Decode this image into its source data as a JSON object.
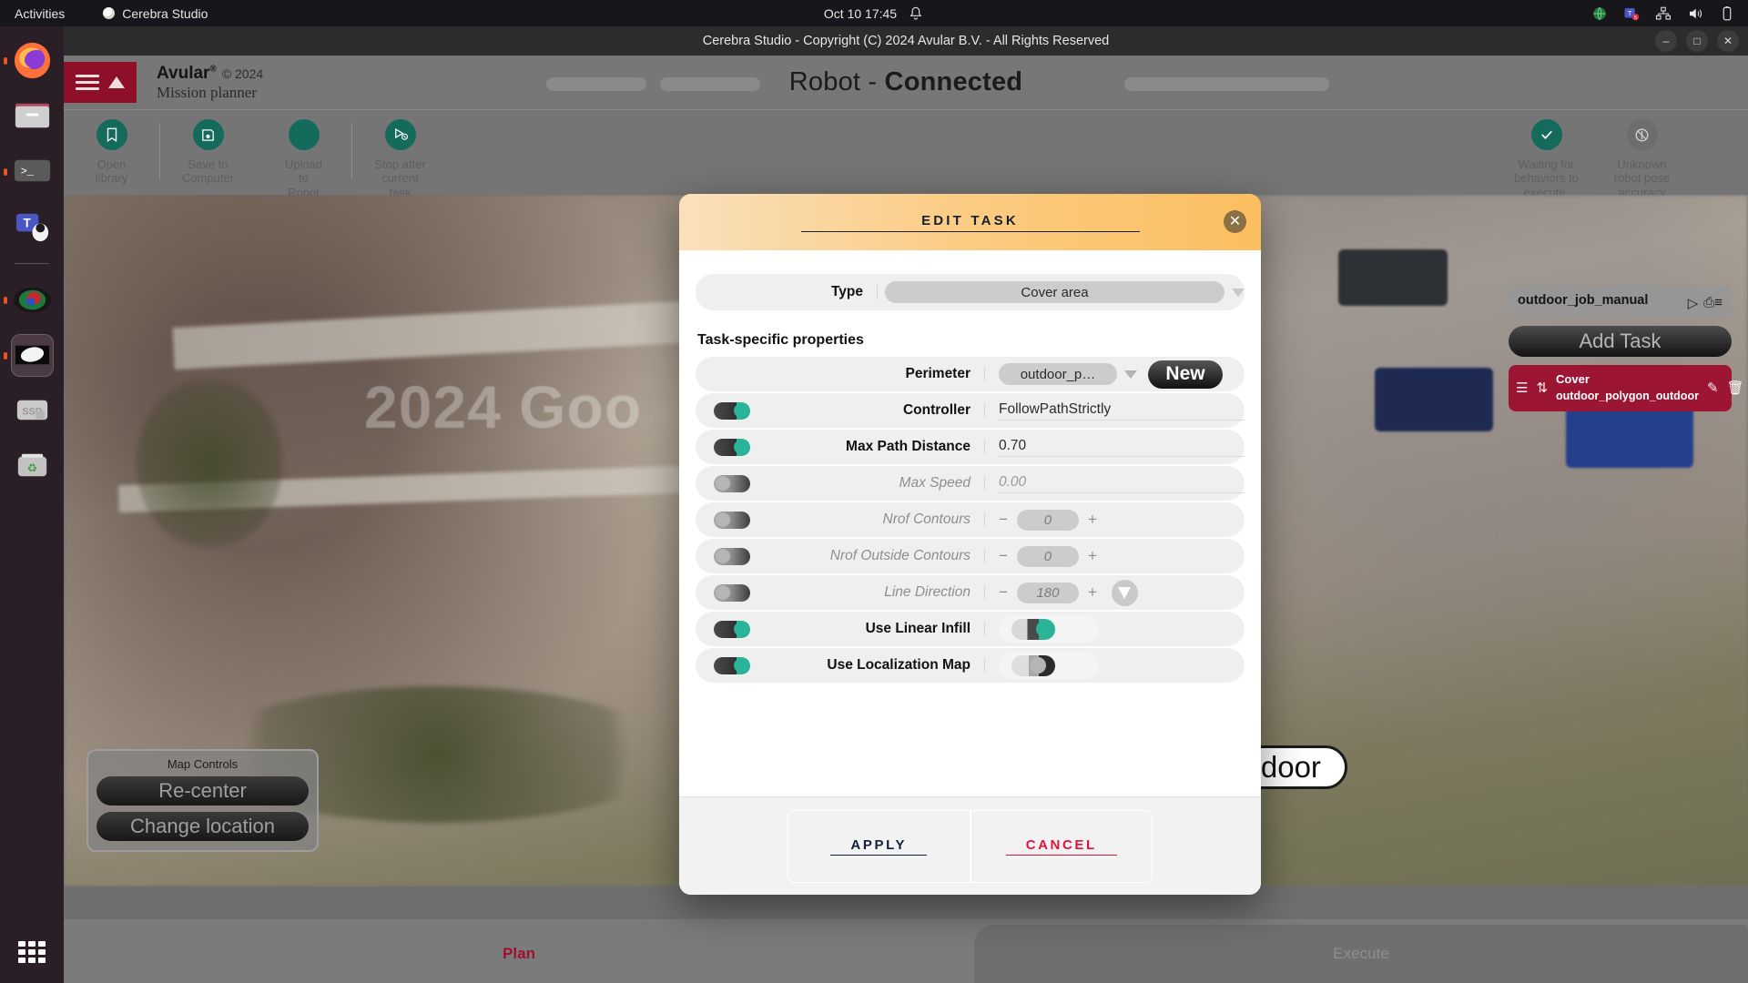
{
  "os": {
    "activities": "Activities",
    "app_name": "Cerebra Studio",
    "clock": "Oct 10  17:45",
    "tray_icons": [
      "globe-icon",
      "teams-icon",
      "network-icon",
      "volume-icon",
      "battery-icon"
    ],
    "dock_items": [
      {
        "name": "firefox",
        "running": true
      },
      {
        "name": "files",
        "running": false
      },
      {
        "name": "terminal",
        "running": true
      },
      {
        "name": "teams",
        "running": false
      },
      {
        "name": "cerebra-globe",
        "running": true
      },
      {
        "name": "media-player",
        "running": true,
        "active": true
      },
      {
        "name": "ssd-drive",
        "label": "SSD",
        "running": false
      },
      {
        "name": "trash",
        "running": false
      }
    ],
    "show_apps": "show-applications"
  },
  "window": {
    "title": "Cerebra Studio - Copyright (C) 2024 Avular B.V. - All Rights Reserved",
    "minimize": "–",
    "maximize": "□",
    "close": "✕"
  },
  "header": {
    "menu_icon": "hamburger-menu-icon",
    "logo_icon": "avular-caret-icon",
    "brand": "Avular",
    "brand_sup": "®",
    "copyright": "© 2024",
    "subtitle": "Mission planner",
    "robot_label": "Robot",
    "robot_dash": " - ",
    "robot_status": "Connected"
  },
  "toolbar": {
    "left_items": [
      {
        "label": "Open\nlibrary",
        "icon": "book-icon",
        "style": "green"
      },
      {
        "label": "Save to\nComputer",
        "icon": "floppy-disk-icon",
        "style": "green"
      },
      {
        "label": "Upload\nto\nRobot",
        "icon": "upload-icon",
        "style": "green"
      },
      {
        "label": "Stop after\ncurrent\ntask",
        "icon": "stop-after-task-icon",
        "style": "green"
      }
    ],
    "right_items": [
      {
        "label": "Waiting for\nbehaviors to\nexecute.",
        "icon": "check-icon",
        "style": "green"
      },
      {
        "label": "Unknown\nrobot pose\naccuracy",
        "icon": "no-location-icon",
        "style": "gray"
      }
    ]
  },
  "map": {
    "watermark": "2024 Goo",
    "polygon_label": "outdoor",
    "controls_title": "Map Controls",
    "recenter_label": "Re-center",
    "change_location_label": "Change location"
  },
  "task_panel": {
    "job_name": "outdoor_job_manual",
    "play_icon": "play-icon",
    "list_icon": "clipboard-list-icon",
    "add_task_label": "Add Task",
    "tasks": [
      {
        "drag_icon": "drag-handle-icon",
        "type_icon": "path-icon",
        "title": "Cover",
        "subtitle": "outdoor_polygon_outdoor",
        "edit_icon": "pencil-icon",
        "delete_icon": "trash-icon"
      }
    ]
  },
  "tabs": {
    "plan": "Plan",
    "execute": "Execute",
    "active": "plan"
  },
  "modal": {
    "title": "EDIT TASK",
    "close_icon": "close-icon",
    "type_label": "Type",
    "type_value": "Cover area",
    "section_label": "Task-specific properties",
    "rows": [
      {
        "kind": "select-new",
        "label": "Perimeter",
        "value": "outdoor_p…",
        "new_label": "New",
        "toggle": null,
        "enabled": true
      },
      {
        "kind": "text",
        "label": "Controller",
        "value": "FollowPathStrictly",
        "toggle": "on",
        "enabled": true
      },
      {
        "kind": "text",
        "label": "Max Path Distance",
        "value": "0.70",
        "toggle": "on",
        "enabled": true
      },
      {
        "kind": "text",
        "label": "Max Speed",
        "value": "0.00",
        "toggle": "off",
        "enabled": false
      },
      {
        "kind": "stepper",
        "label": "Nrof Contours",
        "value": "0",
        "minus": "−",
        "plus": "+",
        "toggle": "off",
        "enabled": false
      },
      {
        "kind": "stepper",
        "label": "Nrof Outside Contours",
        "value": "0",
        "minus": "−",
        "plus": "+",
        "toggle": "off",
        "enabled": false
      },
      {
        "kind": "stepper-dir",
        "label": "Line Direction",
        "value": "180",
        "minus": "−",
        "plus": "+",
        "toggle": "off",
        "enabled": false
      },
      {
        "kind": "switch",
        "label": "Use Linear Infill",
        "value_switch": "on",
        "toggle": "on",
        "enabled": true
      },
      {
        "kind": "switch",
        "label": "Use Localization Map",
        "value_switch": "off",
        "toggle": "on",
        "enabled": true
      }
    ],
    "apply_label": "APPLY",
    "cancel_label": "CANCEL"
  },
  "colors": {
    "brand_red": "#8e0f28",
    "accent_green": "#146b5c",
    "toggle_green": "#2ab396",
    "modal_header_orange": "#fbbe5f",
    "cancel_red": "#e0143c",
    "apply_navy": "#13203a",
    "task_card_red": "#9c1633"
  }
}
